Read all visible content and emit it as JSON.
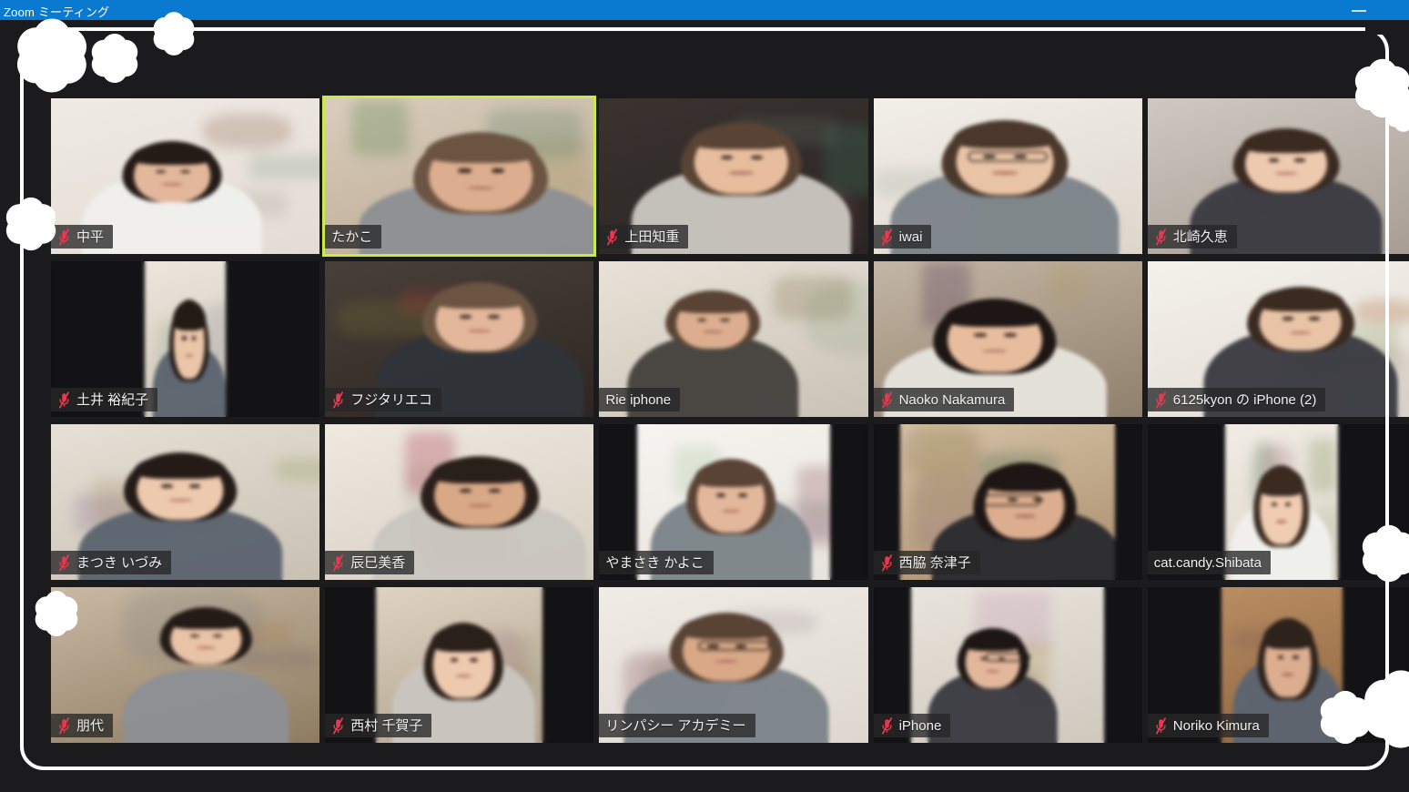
{
  "window": {
    "title": "Zoom ミーティング",
    "minimize_label": "最小化",
    "titlebar_color": "#0a7ad1"
  },
  "meeting": {
    "view": "ギャラリービュー",
    "participant_count": 20,
    "grid": {
      "columns": 5,
      "rows": 4
    },
    "active_speaker": "たかこ",
    "active_border_color": "#c9e94d",
    "mute_icon_color": "#e8384f",
    "icons": {
      "muted": "microphone-muted-icon",
      "minimize": "window-minimize-icon",
      "flower": "flower-decoration-icon"
    }
  },
  "participants": [
    {
      "name": "中平",
      "muted": true,
      "active": false,
      "row": 1,
      "col": 1
    },
    {
      "name": "たかこ",
      "muted": false,
      "active": true,
      "row": 1,
      "col": 2
    },
    {
      "name": "上田知重",
      "muted": true,
      "active": false,
      "row": 1,
      "col": 3
    },
    {
      "name": "iwai",
      "muted": true,
      "active": false,
      "row": 1,
      "col": 4
    },
    {
      "name": "北崎久恵",
      "muted": true,
      "active": false,
      "row": 1,
      "col": 5
    },
    {
      "name": "土井 裕紀子",
      "muted": true,
      "active": false,
      "row": 2,
      "col": 1
    },
    {
      "name": "フジタリエコ",
      "muted": true,
      "active": false,
      "row": 2,
      "col": 2
    },
    {
      "name": "Rie iphone",
      "muted": false,
      "active": false,
      "row": 2,
      "col": 3
    },
    {
      "name": "Naoko Nakamura",
      "muted": true,
      "active": false,
      "row": 2,
      "col": 4
    },
    {
      "name": "6125kyon の iPhone (2)",
      "muted": true,
      "active": false,
      "row": 2,
      "col": 5
    },
    {
      "name": "まつき いづみ",
      "muted": true,
      "active": false,
      "row": 3,
      "col": 1
    },
    {
      "name": "辰巳美香",
      "muted": true,
      "active": false,
      "row": 3,
      "col": 2
    },
    {
      "name": "やまさき かよこ",
      "muted": false,
      "active": false,
      "row": 3,
      "col": 3
    },
    {
      "name": "西脇 奈津子",
      "muted": true,
      "active": false,
      "row": 3,
      "col": 4
    },
    {
      "name": "cat.candy.Shibata",
      "muted": false,
      "active": false,
      "row": 3,
      "col": 5
    },
    {
      "name": "朋代",
      "muted": true,
      "active": false,
      "row": 4,
      "col": 1
    },
    {
      "name": "西村 千賀子",
      "muted": true,
      "active": false,
      "row": 4,
      "col": 2
    },
    {
      "name": "リンパシー アカデミー",
      "muted": false,
      "active": false,
      "row": 4,
      "col": 3
    },
    {
      "name": "iPhone",
      "muted": true,
      "active": false,
      "row": 4,
      "col": 4
    },
    {
      "name": "Noriko Kimura",
      "muted": true,
      "active": false,
      "row": 4,
      "col": 5
    }
  ]
}
